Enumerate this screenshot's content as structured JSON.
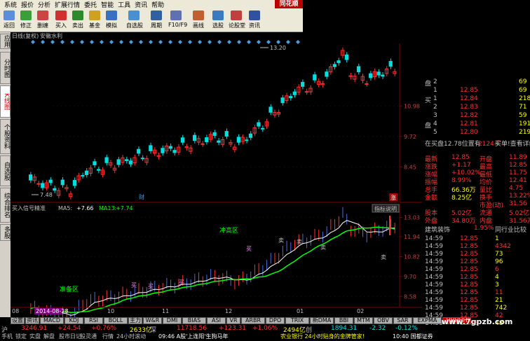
{
  "menubar": {
    "items": [
      "系统",
      "报价",
      "分析",
      "扩展行情",
      "委托",
      "智能",
      "工具",
      "资讯",
      "帮助"
    ],
    "logo": "同花顺"
  },
  "toolbar": {
    "buttons": [
      "返回",
      "修正",
      "删缠",
      "买入",
      "卖出",
      "基金",
      "模拟",
      "自选股",
      "周期",
      "F10/F9",
      "画线",
      "选股",
      "论股堂",
      "资讯"
    ]
  },
  "left_tabs": [
    "应用",
    "分时图",
    "K线图",
    "个股资料",
    "自选股",
    "综合排名",
    "多股"
  ],
  "chart_header": {
    "period": "日线(复权)",
    "stock_name": "安徽水利"
  },
  "price_labels": {
    "high": "13.20",
    "low": "7.48",
    "axis": [
      "10.98",
      "9.72",
      "8.45"
    ],
    "cai": "财",
    "zhang": "涨"
  },
  "indicator": {
    "name": "买入信号精准",
    "ma5_label": "MA5:",
    "ma5_value": "+7.66",
    "ma13_label": "MA13:",
    "ma13_value": "+7.74",
    "button": "指标说明",
    "axis": [
      "13.03",
      "11.94",
      "10.82",
      "9.70",
      "8.58"
    ],
    "zone_label": "冲高区",
    "accum_label": "准备区",
    "signals": [
      "买",
      "买",
      "卖",
      "买",
      "卖",
      "卖",
      "买",
      "卖"
    ]
  },
  "date_axis": {
    "labels": [
      "08",
      "2014-08-28",
      "10",
      "11",
      "12",
      "01",
      "02"
    ],
    "highlight": "2014-08-28 四"
  },
  "bottom_tabs": [
    "设置",
    "资讯",
    "MACD",
    "KDJ",
    "RSI",
    "BOLL",
    "主力",
    "W&R",
    "DMI",
    "BIAS",
    "ASI",
    "VR",
    "ARBR",
    "DPO",
    "TRIX",
    "新DMA",
    "BBI",
    "MTM",
    "OBV",
    "SAR",
    "EXPMA",
    "HHHHH"
  ],
  "index_bar": {
    "sh_label": "沪",
    "sh_value": "3246.91",
    "sh_change": "+24.54",
    "sh_pct": "+0.76%",
    "sh_amount": "2633亿",
    "sz_label": "深",
    "sz_value": "11718.56",
    "sz_change": "+123.31",
    "sz_pct": "+1.06%",
    "sz_amount": "2494亿",
    "cy_label": "创",
    "cy_value": "1894.31",
    "cy_change": "-2.32",
    "cy_pct": "-0.12%"
  },
  "status_bar": {
    "items": [
      "手机",
      "锁定",
      "实盘",
      "解盘",
      "股市日记",
      "股灵通",
      "行情",
      "24小时滚动"
    ],
    "news": "09:46 A股'上连阳'生狗马年",
    "news2": "农业银行 24小时贴身的金牌管家!",
    "time": "10:40 国都证券"
  },
  "order_book": {
    "sell": [
      {
        "label": "盘",
        "level": "2",
        "price": "",
        "vol": "69"
      },
      {
        "label": "",
        "level": "1",
        "price": "12.85",
        "vol": "69"
      },
      {
        "label": "买",
        "level": "1",
        "price": "12.84",
        "vol": "218"
      },
      {
        "label": "",
        "level": "2",
        "price": "12.83",
        "vol": "71"
      },
      {
        "label": "",
        "level": "3",
        "price": "12.82",
        "vol": "59"
      },
      {
        "label": "盘",
        "level": "4",
        "price": "12.81",
        "vol": "191"
      },
      {
        "label": "",
        "level": "5",
        "price": "12.80",
        "vol": "219"
      }
    ],
    "buy_info": "在买盘12.78位置有",
    "buy_info_vol": "2124手",
    "buy_info_btn": "买单!查看详细"
  },
  "quote": {
    "rows": [
      {
        "l1": "最新",
        "v1": "12.85",
        "l2": "开盘",
        "v2": "11.89"
      },
      {
        "l1": "涨跌",
        "v1": "+1.17",
        "l2": "最高",
        "v2": "12.85"
      },
      {
        "l1": "涨幅",
        "v1": "+10.02%",
        "l2": "最低",
        "v2": "11.75"
      },
      {
        "l1": "振幅",
        "v1": "8.99%",
        "l2": "均价",
        "v2": "12.41"
      },
      {
        "l1": "总手",
        "v1": "66.36万",
        "l2": "量比",
        "v2": "4.75"
      },
      {
        "l1": "金额",
        "v1": "8.25亿",
        "l2": "换手",
        "v2": "13.22%"
      },
      {
        "l1": "",
        "v1": "",
        "l2": "市盈(动)",
        "v2": "31.56"
      },
      {
        "l1": "股本",
        "v1": "5.02亿",
        "l2": "流通",
        "v2": "5.02亿"
      },
      {
        "l1": "外盘",
        "v1": "34.80万",
        "l2": "内盘",
        "v2": "31.56万"
      }
    ],
    "industry": "建筑装饰",
    "industry_pct": "1.95%",
    "industry_btn": "同行业比较"
  },
  "ticks": [
    {
      "t": "14:59",
      "p": "12.85",
      "v": "1"
    },
    {
      "t": "14:59",
      "p": "12.85",
      "v": "4342"
    },
    {
      "t": "14:59",
      "p": "12.85",
      "v": "73"
    },
    {
      "t": "14:59",
      "p": "12.85",
      "v": "96"
    },
    {
      "t": "14:59",
      "p": "12.85",
      "v": "6"
    },
    {
      "t": "14:59",
      "p": "12.85",
      "v": "4"
    },
    {
      "t": "14:59",
      "p": "12.85",
      "v": "3"
    },
    {
      "t": "14:59",
      "p": "12.85",
      "v": "11"
    },
    {
      "t": "14:59",
      "p": "12.85",
      "v": "21"
    },
    {
      "t": "14:59",
      "p": "12.85",
      "v": "742"
    },
    {
      "t": "14:59",
      "p": "12.85",
      "v": "42"
    },
    {
      "t": "14:59",
      "p": "12.85",
      "v": "48"
    }
  ],
  "watermark": "www.7gpzb.com",
  "colors": {
    "up": "#ff3030",
    "down": "#00e0e0",
    "ma5": "#ffffff",
    "ma13": "#00ff00",
    "label_red": "#ff4040",
    "yellow": "#ffff00"
  }
}
